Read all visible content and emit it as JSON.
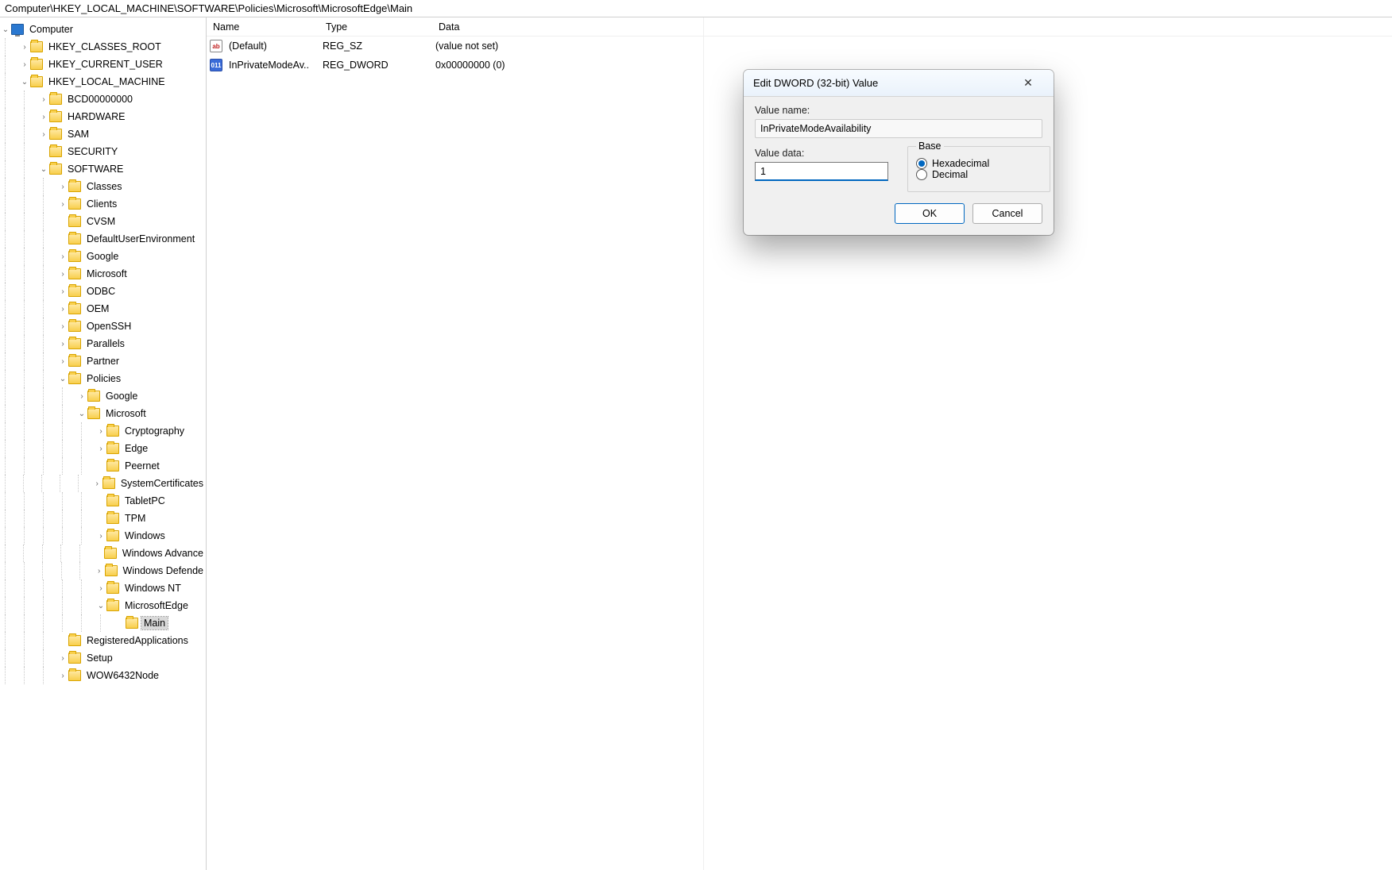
{
  "address": "Computer\\HKEY_LOCAL_MACHINE\\SOFTWARE\\Policies\\Microsoft\\MicrosoftEdge\\Main",
  "columns": {
    "name": "Name",
    "type": "Type",
    "data": "Data"
  },
  "rows": [
    {
      "icon": "sz",
      "name": "(Default)",
      "type": "REG_SZ",
      "data": "(value not set)"
    },
    {
      "icon": "dw",
      "name": "InPrivateModeAv..",
      "type": "REG_DWORD",
      "data": "0x00000000 (0)"
    }
  ],
  "tree": {
    "root": "Computer",
    "hives": [
      "HKEY_CLASSES_ROOT",
      "HKEY_CURRENT_USER",
      "HKEY_LOCAL_MACHINE"
    ],
    "hklm": [
      "BCD00000000",
      "HARDWARE",
      "SAM",
      "SECURITY",
      "SOFTWARE"
    ],
    "software": [
      "Classes",
      "Clients",
      "CVSM",
      "DefaultUserEnvironment",
      "Google",
      "Microsoft",
      "ODBC",
      "OEM",
      "OpenSSH",
      "Parallels",
      "Partner",
      "Policies",
      "RegisteredApplications",
      "Setup",
      "WOW6432Node"
    ],
    "policies": [
      "Google",
      "Microsoft"
    ],
    "pol_microsoft": [
      "Cryptography",
      "Edge",
      "Peernet",
      "SystemCertificates",
      "TabletPC",
      "TPM",
      "Windows",
      "Windows Advance",
      "Windows Defende",
      "Windows NT",
      "MicrosoftEdge"
    ],
    "msedge": [
      "Main"
    ]
  },
  "dialog": {
    "title": "Edit DWORD (32-bit) Value",
    "value_name_label": "Value name:",
    "value_name": "InPrivateModeAvailability",
    "value_data_label": "Value data:",
    "value_data": "1",
    "base_label": "Base",
    "hex_label": "Hexadecimal",
    "dec_label": "Decimal",
    "ok": "OK",
    "cancel": "Cancel"
  }
}
